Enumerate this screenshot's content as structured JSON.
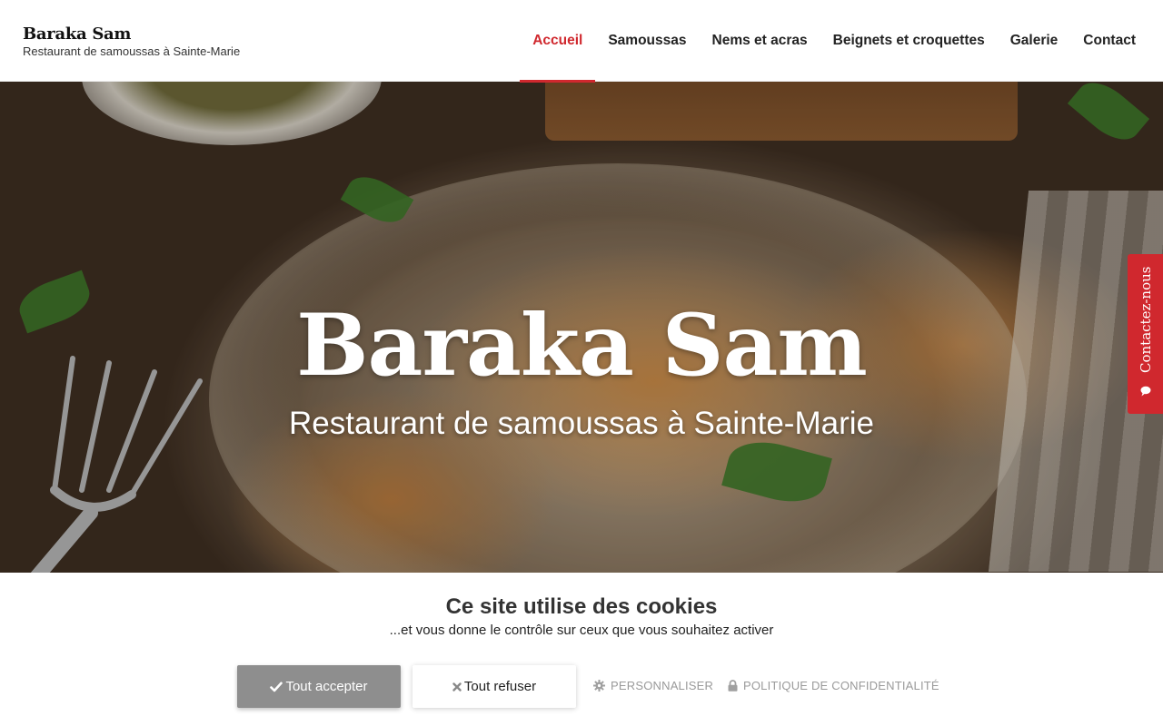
{
  "header": {
    "brand_title": "Baraka Sam",
    "brand_subtitle": "Restaurant de samoussas à Sainte-Marie",
    "nav": [
      {
        "label": "Accueil",
        "active": true
      },
      {
        "label": "Samoussas",
        "active": false
      },
      {
        "label": "Nems et acras",
        "active": false
      },
      {
        "label": "Beignets et croquettes",
        "active": false
      },
      {
        "label": "Galerie",
        "active": false
      },
      {
        "label": "Contact",
        "active": false
      }
    ],
    "accent_color": "#d0282e"
  },
  "hero": {
    "title": "Baraka Sam",
    "subtitle": "Restaurant de samoussas à Sainte-Marie"
  },
  "contact_tab": {
    "label": "Contactez-nous",
    "icon": "chat-bubble-icon"
  },
  "cookie_banner": {
    "title": "Ce site utilise des cookies",
    "description": "...et vous donne le contrôle sur ceux que vous souhaitez activer",
    "accept_label": "Tout accepter",
    "accept_icon": "check-icon",
    "refuse_label": "Tout refuser",
    "refuse_icon": "close-icon",
    "customize_label": "PERSONNALISER",
    "customize_icon": "gear-icon",
    "privacy_label": "POLITIQUE DE CONFIDENTIALITÉ",
    "privacy_icon": "lock-icon"
  }
}
